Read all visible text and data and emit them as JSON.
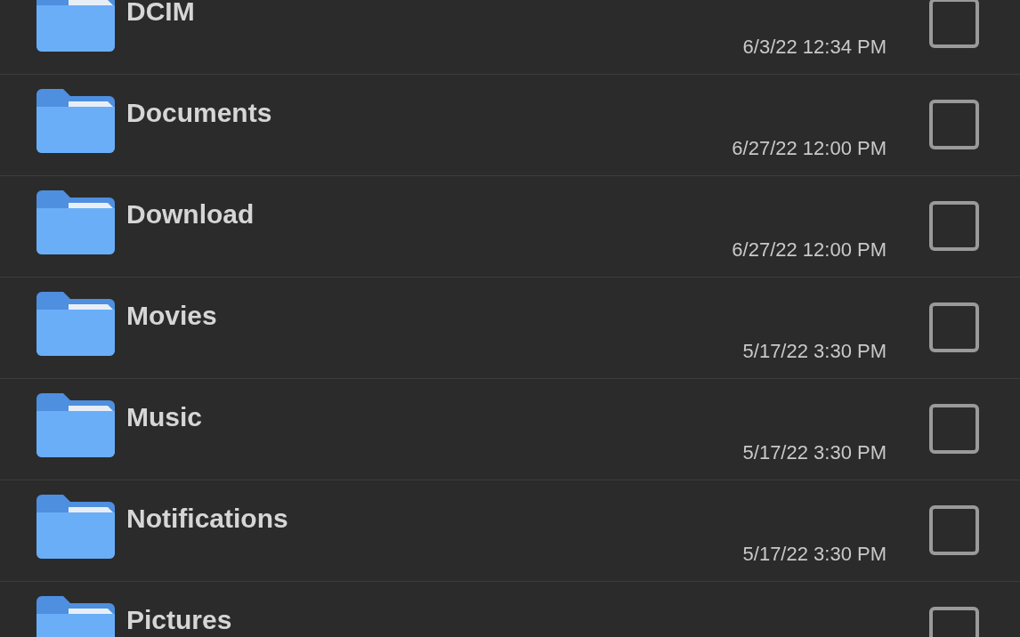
{
  "folders": [
    {
      "name": "DCIM",
      "date": "6/3/22 12:34 PM",
      "checked": false
    },
    {
      "name": "Documents",
      "date": "6/27/22 12:00 PM",
      "checked": false
    },
    {
      "name": "Download",
      "date": "6/27/22 12:00 PM",
      "checked": false
    },
    {
      "name": "Movies",
      "date": "5/17/22 3:30 PM",
      "checked": false
    },
    {
      "name": "Music",
      "date": "5/17/22 3:30 PM",
      "checked": false
    },
    {
      "name": "Notifications",
      "date": "5/17/22 3:30 PM",
      "checked": false
    },
    {
      "name": "Pictures",
      "checked": false
    }
  ]
}
